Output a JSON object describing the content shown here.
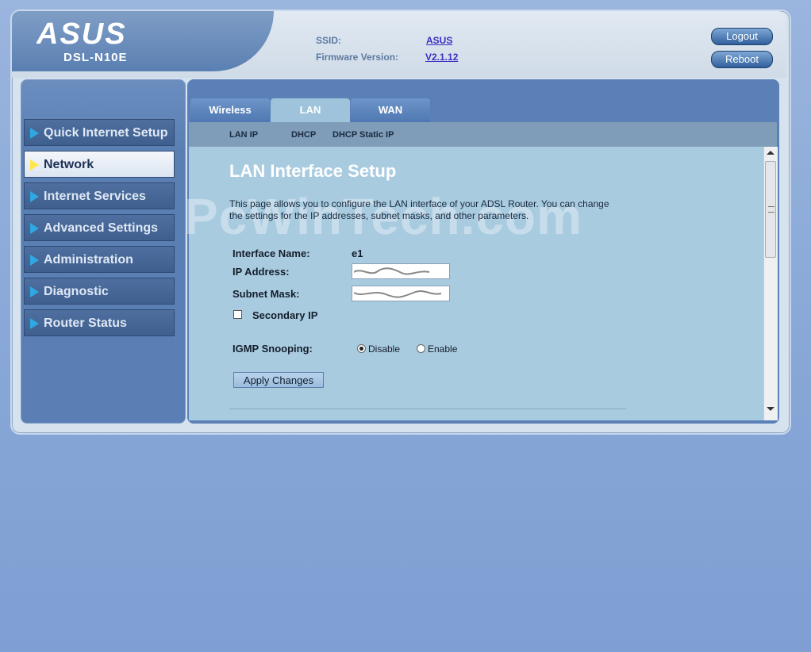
{
  "header": {
    "brand": "ASUS",
    "model": "DSL-N10E",
    "ssid_label": "SSID:",
    "ssid_value": "ASUS",
    "firmware_label": "Firmware Version:",
    "firmware_value": "V2.1.12",
    "logout_label": "Logout",
    "reboot_label": "Reboot"
  },
  "sidebar": {
    "items": [
      {
        "label": "Quick Internet Setup",
        "active": false
      },
      {
        "label": "Network",
        "active": true
      },
      {
        "label": "Internet Services",
        "active": false
      },
      {
        "label": "Advanced Settings",
        "active": false
      },
      {
        "label": "Administration",
        "active": false
      },
      {
        "label": "Diagnostic",
        "active": false
      },
      {
        "label": "Router Status",
        "active": false
      }
    ]
  },
  "tabs": [
    {
      "label": "Wireless",
      "active": false
    },
    {
      "label": "LAN",
      "active": true
    },
    {
      "label": "WAN",
      "active": false
    }
  ],
  "subtabs": [
    "LAN IP",
    "DHCP",
    "DHCP Static IP"
  ],
  "main": {
    "title": "LAN Interface Setup",
    "description": "This page allows you to configure the LAN interface of your ADSL Router. You can change the settings for the IP addresses, subnet masks, and other parameters.",
    "watermark": "PcWinTech.com",
    "interface_name_label": "Interface Name:",
    "interface_name_value": "e1",
    "ip_address_label": "IP Address:",
    "subnet_mask_label": "Subnet Mask:",
    "secondary_ip_label": "Secondary IP",
    "igmp_label": "IGMP Snooping:",
    "igmp_options": [
      "Disable",
      "Enable"
    ],
    "igmp_selected": "Disable",
    "apply_label": "Apply Changes"
  },
  "colors": {
    "accent": "#5b80b7",
    "panel": "#a9cbe0",
    "active_arrow": "#ffe64a",
    "nav_arrow": "#2fa8e2"
  }
}
